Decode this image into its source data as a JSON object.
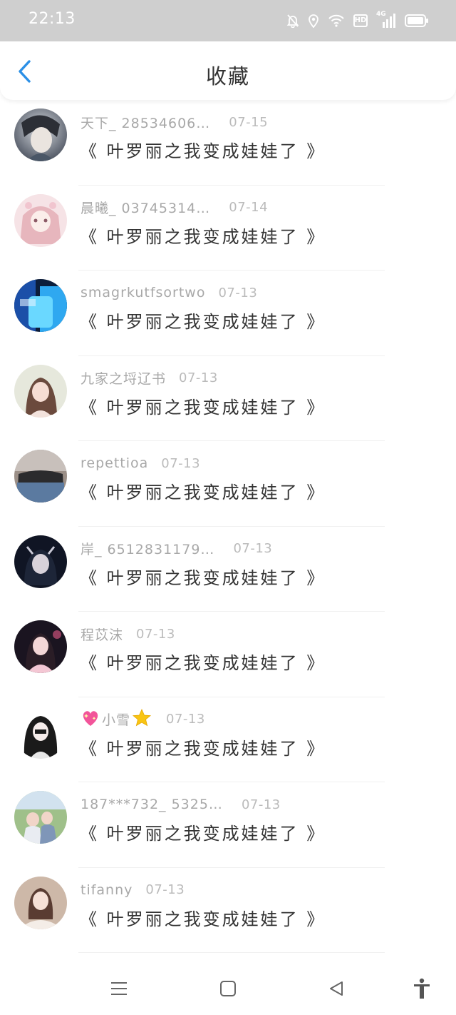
{
  "status_bar": {
    "time": "22:13",
    "network_label": "4G",
    "icons": [
      "mute-bell-icon",
      "location-icon",
      "wifi-icon",
      "hd-icon",
      "signal-icon",
      "battery-icon"
    ]
  },
  "header": {
    "title": "收藏",
    "back_icon": "chevron-left-icon",
    "accent_color": "#2b8fe6"
  },
  "items": [
    {
      "username": "天下_ 28534606…",
      "date": "07-15",
      "title": "《 叶罗丽之我变成娃娃了 》"
    },
    {
      "username": "晨曦_ 03745314…",
      "date": "07-14",
      "title": "《 叶罗丽之我变成娃娃了 》"
    },
    {
      "username": "smagrkutfsortwo",
      "date": "07-13",
      "title": "《 叶罗丽之我变成娃娃了 》"
    },
    {
      "username": "九家之埒辽书",
      "date": "07-13",
      "title": "《 叶罗丽之我变成娃娃了 》"
    },
    {
      "username": "repettioa",
      "date": "07-13",
      "title": "《 叶罗丽之我变成娃娃了 》"
    },
    {
      "username": "岸_ 6512831179…",
      "date": "07-13",
      "title": "《 叶罗丽之我变成娃娃了 》"
    },
    {
      "username": "程苡沫",
      "date": "07-13",
      "title": "《 叶罗丽之我变成娃娃了 》"
    },
    {
      "username": "小雪",
      "username_prefix_icon": "sparkling-heart-icon",
      "username_suffix_icon": "star-icon",
      "date": "07-13",
      "title": "《 叶罗丽之我变成娃娃了 》"
    },
    {
      "username": "187***732_ 5325…",
      "date": "07-13",
      "title": "《 叶罗丽之我变成娃娃了 》"
    },
    {
      "username": "tifanny",
      "date": "07-13",
      "title": "《 叶罗丽之我变成娃娃了 》"
    }
  ],
  "nav_bar": {
    "icons": [
      "menu-icon",
      "home-square-icon",
      "back-triangle-icon",
      "accessibility-icon"
    ]
  }
}
